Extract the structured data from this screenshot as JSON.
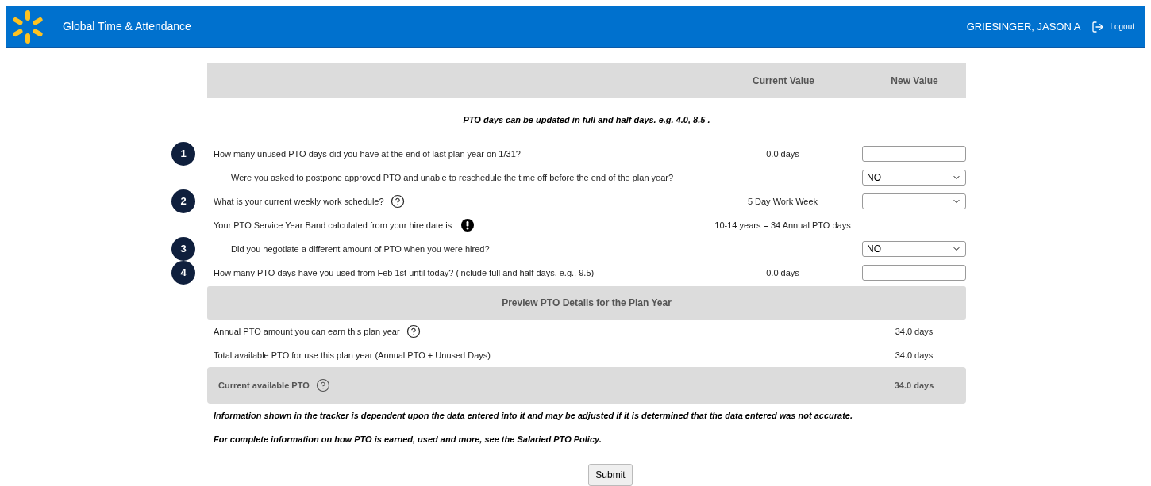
{
  "header": {
    "title": "Global Time & Attendance",
    "user": "GRIESINGER, JASON A",
    "logout": "Logout"
  },
  "table_header": {
    "current": "Current Value",
    "new": "New Value"
  },
  "note": "PTO days can be updated in full and half days. e.g. 4.0, 8.5 .",
  "questions": [
    {
      "number": "1",
      "text": "How many unused PTO days did you have at the end of last plan year on 1/31?",
      "indented": false,
      "current": "0.0 days",
      "control": {
        "kind": "input"
      }
    },
    {
      "text": "Were you asked to postpone approved PTO and unable to reschedule the time off before the end of the plan year?",
      "indented": true,
      "control": {
        "kind": "select",
        "value": "NO"
      }
    },
    {
      "number": "2",
      "text": "What is your current weekly work schedule?",
      "indented": false,
      "kind": "help",
      "current": "5 Day Work Week",
      "control": {
        "kind": "select"
      }
    },
    {
      "text": "Your PTO Service Year Band calculated from your hire date is",
      "indented": false,
      "kind": "alert",
      "current": "10-14 years = 34 Annual PTO days"
    },
    {
      "number": "3",
      "text": "Did you negotiate a different amount of PTO when you were hired?",
      "indented": true,
      "control": {
        "kind": "select",
        "value": "NO"
      }
    },
    {
      "number": "4",
      "text": "How many PTO days have you used from Feb 1st until today? (include full and half days, e.g., 9.5)",
      "indented": false,
      "current": "0.0 days",
      "control": {
        "kind": "input"
      }
    }
  ],
  "preview": {
    "title": "Preview PTO Details for the Plan Year",
    "rows": [
      {
        "label": "Annual PTO amount you can earn this plan year",
        "help": true,
        "value": "34.0 days"
      },
      {
        "label": "Total available PTO for use this plan year (Annual PTO + Unused Days)",
        "help": false,
        "value": "34.0 days"
      }
    ]
  },
  "total": {
    "label": "Current available PTO",
    "help": true,
    "value": "34.0 days"
  },
  "notes": [
    "Information shown in the tracker is dependent upon the data entered into it and may be adjusted if it is determined that the data entered was not accurate.",
    "For complete information on how PTO is earned, used and more, see the Salaried PTO Policy."
  ],
  "submit": "Submit"
}
